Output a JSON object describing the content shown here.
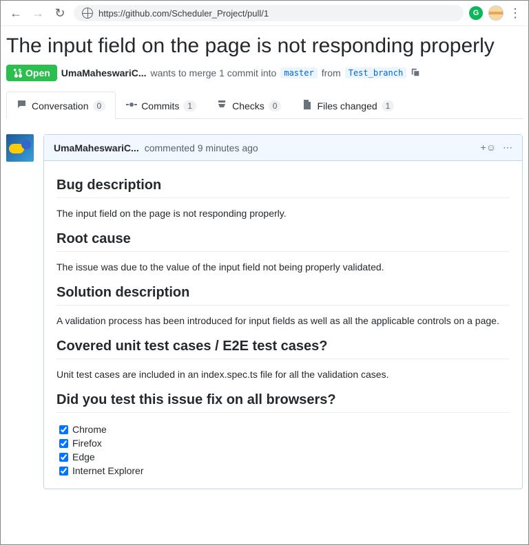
{
  "chrome": {
    "url": "https://github.com/Scheduler_Project/pull/1",
    "ext_letter": "G"
  },
  "pr": {
    "title": "The input field on the page is not responding properly",
    "state": "Open",
    "author": "UmaMaheswariC...",
    "merge_text": "wants to merge 1 commit into",
    "base": "master",
    "from_text": "from",
    "compare": "Test_branch"
  },
  "tabs": {
    "conversation": {
      "label": "Conversation",
      "count": "0"
    },
    "commits": {
      "label": "Commits",
      "count": "1"
    },
    "checks": {
      "label": "Checks",
      "count": "0"
    },
    "files": {
      "label": "Files changed",
      "count": "1"
    }
  },
  "comment": {
    "author": "UmaMaheswariC...",
    "meta": "commented 9 minutes ago",
    "sections": {
      "bug_h": "Bug description",
      "bug_p": "The input field on the page is not responding properly.",
      "root_h": "Root cause",
      "root_p": "The issue was due to the value of the input field not being properly validated.",
      "sol_h": "Solution description",
      "sol_p": "A validation process has been introduced for input fields as well as all the applicable controls on a page.",
      "tests_h": "Covered unit test cases / E2E test cases?",
      "tests_p": "Unit test cases are included in an index.spec.ts file for all the validation cases.",
      "browsers_h": "Did you test this issue fix on all browsers?"
    },
    "browsers": [
      "Chrome",
      "Firefox",
      "Edge",
      "Internet Explorer"
    ]
  }
}
